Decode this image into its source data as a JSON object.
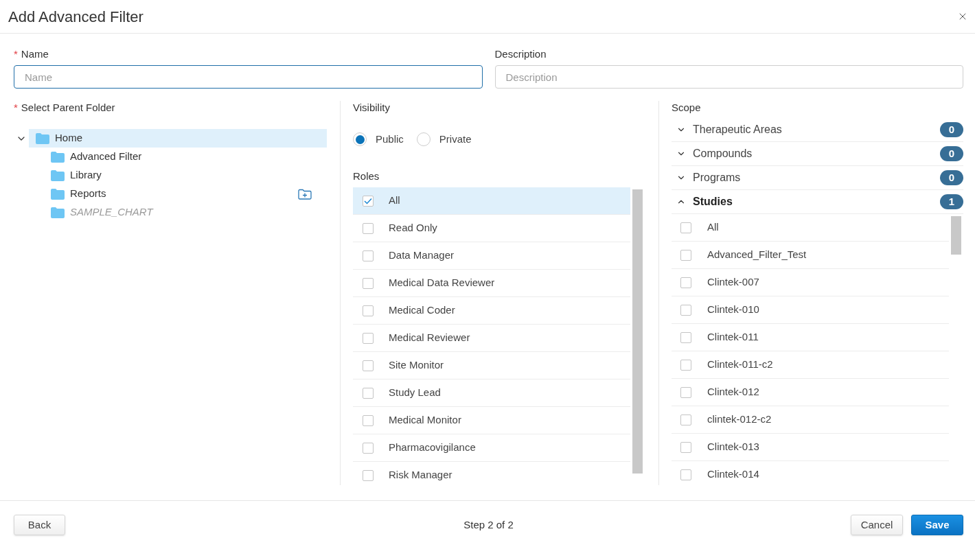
{
  "dialog": {
    "title": "Add Advanced Filter"
  },
  "fields": [
    {
      "label": "Name",
      "required_mark": "*",
      "placeholder": "Name",
      "focused": true
    },
    {
      "label": "Description",
      "placeholder": "Description",
      "focused": false
    }
  ],
  "parent_folder": {
    "label": "Select Parent Folder",
    "required_mark": "*",
    "tree": [
      {
        "name": "Home",
        "expanded": true,
        "selected": true,
        "disabled": false,
        "hovered": false,
        "children": [
          {
            "name": "Advanced Filter",
            "selected": false,
            "disabled": false,
            "hovered": false
          },
          {
            "name": "Library",
            "selected": false,
            "disabled": false,
            "hovered": false
          },
          {
            "name": "Reports",
            "selected": false,
            "disabled": false,
            "hovered": true
          },
          {
            "name": "SAMPLE_CHART",
            "selected": false,
            "disabled": true,
            "hovered": false
          }
        ]
      }
    ]
  },
  "visibility": {
    "label": "Visibility",
    "options": [
      {
        "label": "Public",
        "selected": true
      },
      {
        "label": "Private",
        "selected": false
      }
    ]
  },
  "roles": {
    "label": "Roles",
    "items": [
      {
        "label": "All",
        "checked": true,
        "selected": true
      },
      {
        "label": "Read Only",
        "checked": false,
        "selected": false
      },
      {
        "label": "Data Manager",
        "checked": false,
        "selected": false
      },
      {
        "label": "Medical Data Reviewer",
        "checked": false,
        "selected": false
      },
      {
        "label": "Medical Coder",
        "checked": false,
        "selected": false
      },
      {
        "label": "Medical Reviewer",
        "checked": false,
        "selected": false
      },
      {
        "label": "Site Monitor",
        "checked": false,
        "selected": false
      },
      {
        "label": "Study Lead",
        "checked": false,
        "selected": false
      },
      {
        "label": "Medical Monitor",
        "checked": false,
        "selected": false
      },
      {
        "label": "Pharmacovigilance",
        "checked": false,
        "selected": false
      },
      {
        "label": "Risk Manager",
        "checked": false,
        "selected": false
      }
    ]
  },
  "scope": {
    "label": "Scope",
    "sections": [
      {
        "label": "Therapeutic Areas",
        "count": "0",
        "expanded": false
      },
      {
        "label": "Compounds",
        "count": "0",
        "expanded": false
      },
      {
        "label": "Programs",
        "count": "0",
        "expanded": false
      },
      {
        "label": "Studies",
        "count": "1",
        "expanded": true,
        "items": [
          {
            "label": "All",
            "checked": false,
            "selected": false
          },
          {
            "label": "Advanced_Filter_Test",
            "checked": false,
            "selected": false
          },
          {
            "label": "Clintek-007",
            "checked": false,
            "selected": false
          },
          {
            "label": "Clintek-010",
            "checked": false,
            "selected": false
          },
          {
            "label": "Clintek-011",
            "checked": false,
            "selected": false
          },
          {
            "label": "Clintek-011-c2",
            "checked": false,
            "selected": false
          },
          {
            "label": "Clintek-012",
            "checked": false,
            "selected": false
          },
          {
            "label": "clintek-012-c2",
            "checked": false,
            "selected": false
          },
          {
            "label": "Clintek-013",
            "checked": false,
            "selected": false
          },
          {
            "label": "Clintek-014",
            "checked": false,
            "selected": false
          }
        ]
      }
    ]
  },
  "footer": {
    "back": "Back",
    "step": "Step 2 of 2",
    "buttons": [
      {
        "label": "Cancel",
        "kind": "secondary"
      },
      {
        "label": "Save",
        "kind": "primary"
      }
    ]
  }
}
